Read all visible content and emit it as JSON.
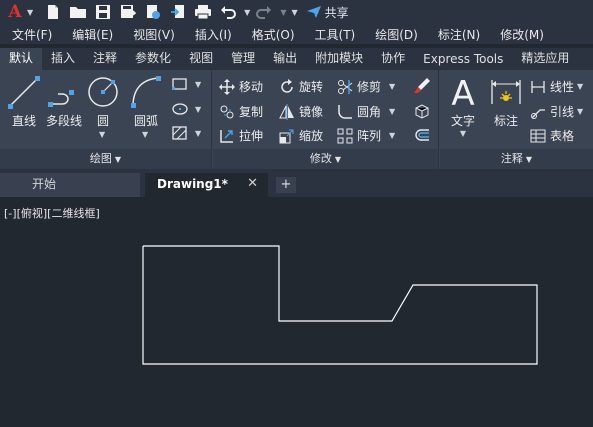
{
  "app": {
    "logo_letter": "A",
    "share_label": "共享"
  },
  "menubar": [
    "文件(F)",
    "编辑(E)",
    "视图(V)",
    "插入(I)",
    "格式(O)",
    "工具(T)",
    "绘图(D)",
    "标注(N)",
    "修改(M)"
  ],
  "ribbon_tabs": [
    "默认",
    "插入",
    "注释",
    "参数化",
    "视图",
    "管理",
    "输出",
    "附加模块",
    "协作",
    "Express Tools",
    "精选应用"
  ],
  "active_tab_index": 0,
  "panels": {
    "draw": {
      "title": "绘图",
      "line": "直线",
      "polyline": "多段线",
      "circle": "圆",
      "arc": "圆弧"
    },
    "modify": {
      "title": "修改",
      "move": "移动",
      "rotate": "旋转",
      "trim": "修剪",
      "copy": "复制",
      "mirror": "镜像",
      "fillet": "圆角",
      "stretch": "拉伸",
      "scale": "缩放",
      "array": "阵列"
    },
    "annotation": {
      "title": "注释",
      "text": "文字",
      "dimension": "标注",
      "linear": "线性",
      "leader": "引线",
      "table": "表格"
    }
  },
  "doc_tabs": {
    "start": "开始",
    "drawing": "Drawing1*",
    "close_glyph": "✕",
    "add_glyph": "+"
  },
  "viewport": {
    "controls": [
      "[-]",
      "[俯视]",
      "[二维线框]"
    ]
  },
  "colors": {
    "background": "#212830",
    "ribbon": "#3b4453",
    "toolbar": "#2b3340",
    "accent_red": "#e4302b",
    "icon_blue": "#4fa3e8",
    "geometry": "#ffffff"
  }
}
